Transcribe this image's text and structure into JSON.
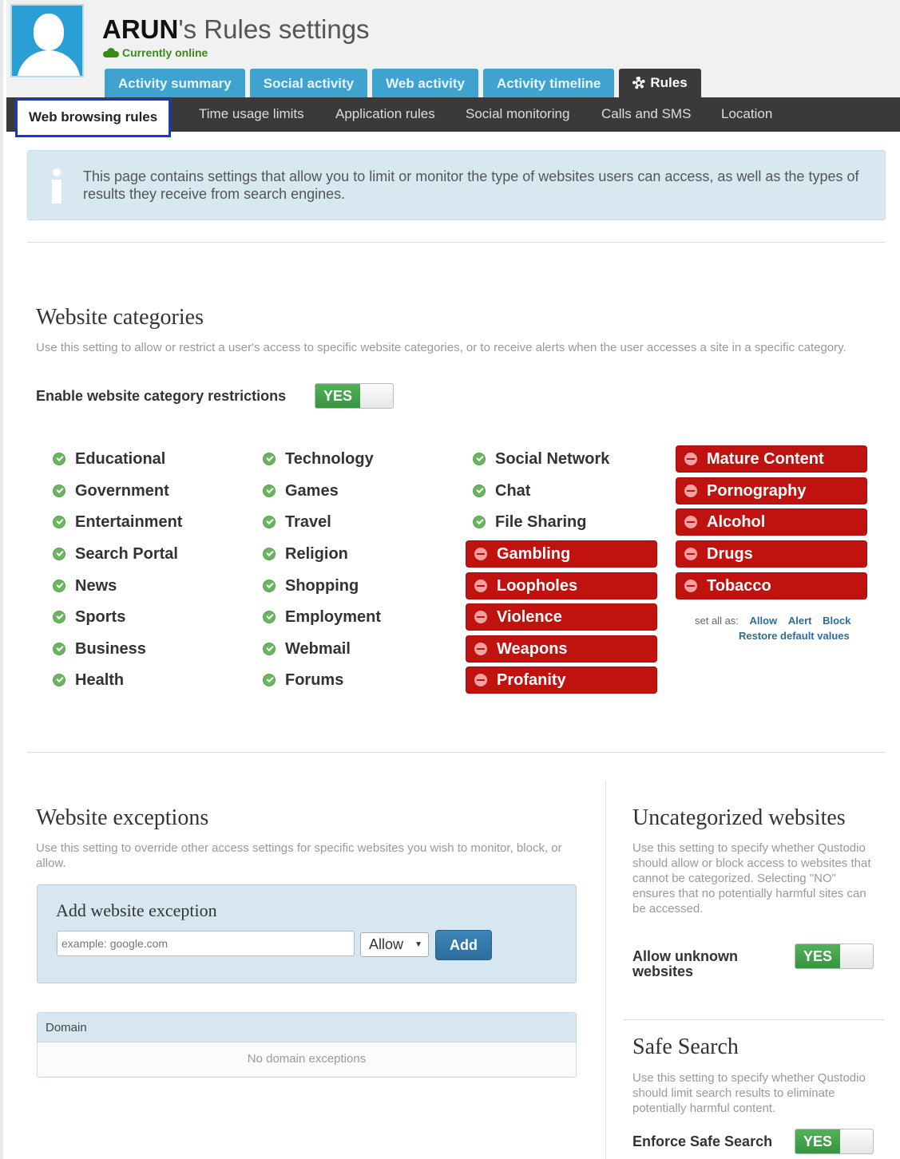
{
  "header": {
    "user_name": "ARUN",
    "title_suffix": "'s Rules settings",
    "status": "Currently online"
  },
  "tabs": [
    {
      "label": "Activity summary"
    },
    {
      "label": "Social activity"
    },
    {
      "label": "Web activity"
    },
    {
      "label": "Activity timeline"
    },
    {
      "label": "Rules"
    }
  ],
  "subnav": [
    {
      "label": "Web browsing rules"
    },
    {
      "label": "Time usage limits"
    },
    {
      "label": "Application rules"
    },
    {
      "label": "Social monitoring"
    },
    {
      "label": "Calls and SMS"
    },
    {
      "label": "Location"
    }
  ],
  "info": {
    "text": "This page contains settings that allow you to limit or monitor the type of websites users can access, as well as the types of results they receive from search engines."
  },
  "categories_section": {
    "title": "Website categories",
    "description": "Use this setting to allow or restrict a user's access to specific website categories, or to receive alerts when the user accesses a site in a specific category.",
    "toggle_label": "Enable website category restrictions",
    "toggle_value": "YES",
    "categories": [
      {
        "label": "Educational",
        "state": "allow"
      },
      {
        "label": "Government",
        "state": "allow"
      },
      {
        "label": "Entertainment",
        "state": "allow"
      },
      {
        "label": "Search Portal",
        "state": "allow"
      },
      {
        "label": "News",
        "state": "allow"
      },
      {
        "label": "Sports",
        "state": "allow"
      },
      {
        "label": "Business",
        "state": "allow"
      },
      {
        "label": "Health",
        "state": "allow"
      },
      {
        "label": "Technology",
        "state": "allow"
      },
      {
        "label": "Games",
        "state": "allow"
      },
      {
        "label": "Travel",
        "state": "allow"
      },
      {
        "label": "Religion",
        "state": "allow"
      },
      {
        "label": "Shopping",
        "state": "allow"
      },
      {
        "label": "Employment",
        "state": "allow"
      },
      {
        "label": "Webmail",
        "state": "allow"
      },
      {
        "label": "Forums",
        "state": "allow"
      },
      {
        "label": "Social Network",
        "state": "allow"
      },
      {
        "label": "Chat",
        "state": "allow"
      },
      {
        "label": "File Sharing",
        "state": "allow"
      },
      {
        "label": "Gambling",
        "state": "block"
      },
      {
        "label": "Loopholes",
        "state": "block"
      },
      {
        "label": "Violence",
        "state": "block"
      },
      {
        "label": "Weapons",
        "state": "block"
      },
      {
        "label": "Profanity",
        "state": "block"
      },
      {
        "label": "Mature Content",
        "state": "block"
      },
      {
        "label": "Pornography",
        "state": "block"
      },
      {
        "label": "Alcohol",
        "state": "block"
      },
      {
        "label": "Drugs",
        "state": "block"
      },
      {
        "label": "Tobacco",
        "state": "block"
      }
    ],
    "set_all_label": "set all as:",
    "set_all_allow": "Allow",
    "set_all_alert": "Alert",
    "set_all_block": "Block",
    "restore_label": "Restore default values"
  },
  "exceptions_section": {
    "title": "Website exceptions",
    "description": "Use this setting to override other access settings for specific websites you wish to monitor, block, or allow.",
    "add_title": "Add website exception",
    "input_placeholder": "example: google.com",
    "select_value": "Allow",
    "add_button": "Add",
    "table_header": "Domain",
    "empty_text": "No domain exceptions"
  },
  "uncategorized_section": {
    "title": "Uncategorized websites",
    "description": "Use this setting to specify whether Qustodio should allow or block access to websites that cannot be categorized. Selecting \"NO\" ensures that no potentially harmful sites can be accessed.",
    "toggle_label": "Allow unknown websites",
    "toggle_value": "YES"
  },
  "safe_search_section": {
    "title": "Safe Search",
    "description": "Use this setting to specify whether Qustodio should limit search results to eliminate potentially harmful content.",
    "toggle_label": "Enforce Safe Search",
    "toggle_value": "YES"
  },
  "colors": {
    "tab_blue": "#3fa3cf",
    "nav_dark": "#3a3a3a",
    "block_red": "#c0120f",
    "allow_green": "#6ab560",
    "toggle_green": "#3f9f47"
  }
}
